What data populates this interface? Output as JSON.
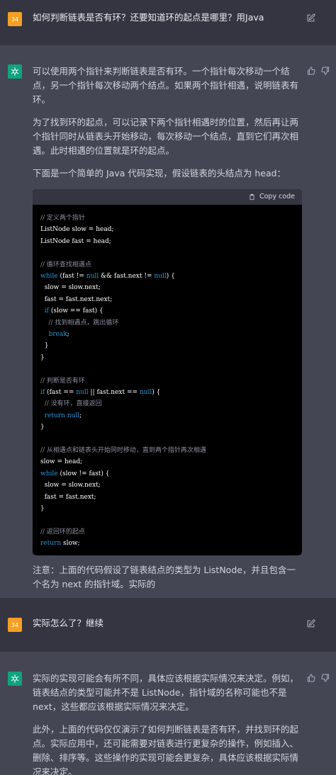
{
  "messages": [
    {
      "role": "user",
      "avatar": "34",
      "text": "如何判断链表是否有环？还要知道环的起点是哪里？用Java"
    },
    {
      "role": "assistant",
      "paragraphs": [
        "可以使用两个指针来判断链表是否有环。一个指针每次移动一个结点，另一个指针每次移动两个结点。如果两个指针相遇，说明链表有环。",
        "为了找到环的起点，可以记录下两个指针相遇时的位置，然后再让两个指针同时从链表头开始移动，每次移动一个结点，直到它们再次相遇。此时相遇的位置就是环的起点。",
        "下面是一个简单的 Java 代码实现，假设链表的头结点为 head："
      ],
      "copy_label": "Copy code",
      "code_lines": [
        "// 定义两个指针",
        "ListNode slow = head;",
        "ListNode fast = head;",
        "",
        "// 循环查找相遇点",
        "while (fast != null && fast.next != null) {",
        "  slow = slow.next;",
        "  fast = fast.next.next;",
        "  if (slow == fast) {",
        "    // 找到相遇点，跳出循环",
        "    break;",
        "  }",
        "}",
        "",
        "// 判断是否有环",
        "if (fast == null || fast.next == null) {",
        "  // 没有环，直接返回",
        "  return null;",
        "}",
        "",
        "// 从相遇点和链表头开始同时移动，直到两个指针再次相遇",
        "slow = head;",
        "while (slow != fast) {",
        "  slow = slow.next;",
        "  fast = fast.next;",
        "}",
        "",
        "// 返回环的起点",
        "return slow;"
      ],
      "after_paragraphs": [
        "注意：上面的代码假设了链表结点的类型为 ListNode，并且包含一个名为 next 的指针域。实际的"
      ]
    },
    {
      "role": "user",
      "avatar": "34",
      "text": "实际怎么了？继续"
    },
    {
      "role": "assistant",
      "paragraphs": [
        "实际的实现可能会有所不同，具体应该根据实际情况来决定。例如，链表结点的类型可能并不是 ListNode，指针域的名称可能也不是 next，这些都应该根据实际情况来决定。",
        "此外，上面的代码仅仅演示了如何判断链表是否有环，并找到环的起点。实际应用中，还可能需要对链表进行更复杂的操作，例如插入、删除、排序等。这些操作的实现可能会更复杂，具体应该根据实际情况来决定。"
      ]
    }
  ],
  "colors": {
    "user_bg": "#343541",
    "bot_bg": "#444654",
    "user_avatar": "#f5a023",
    "bot_avatar": "#10a37f",
    "keyword": "#2e95d3",
    "comment": "#8e8ea0"
  }
}
